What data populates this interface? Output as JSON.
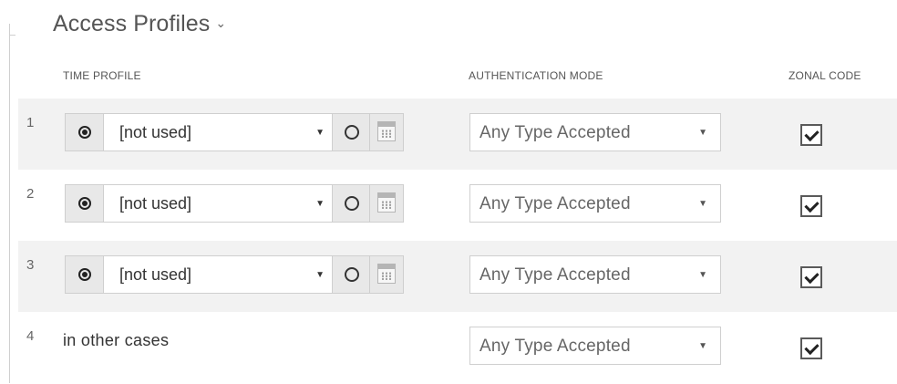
{
  "section": {
    "title": "Access Profiles",
    "chevron": "⌄"
  },
  "columns": {
    "time_profile": "TIME PROFILE",
    "auth_mode": "AUTHENTICATION MODE",
    "zonal_code": "ZONAL CODE"
  },
  "rows": [
    {
      "num": "1",
      "time_profile": "[not used]",
      "auth_mode": "Any Type Accepted",
      "zonal_code_checked": true,
      "shaded": true
    },
    {
      "num": "2",
      "time_profile": "[not used]",
      "auth_mode": "Any Type Accepted",
      "zonal_code_checked": true,
      "shaded": false
    },
    {
      "num": "3",
      "time_profile": "[not used]",
      "auth_mode": "Any Type Accepted",
      "zonal_code_checked": true,
      "shaded": true
    },
    {
      "num": "4",
      "other_text": "in other cases",
      "auth_mode": "Any Type Accepted",
      "zonal_code_checked": true,
      "shaded": false
    }
  ],
  "icons": {
    "select_arrow": "▼",
    "calendar": "calendar-icon"
  }
}
